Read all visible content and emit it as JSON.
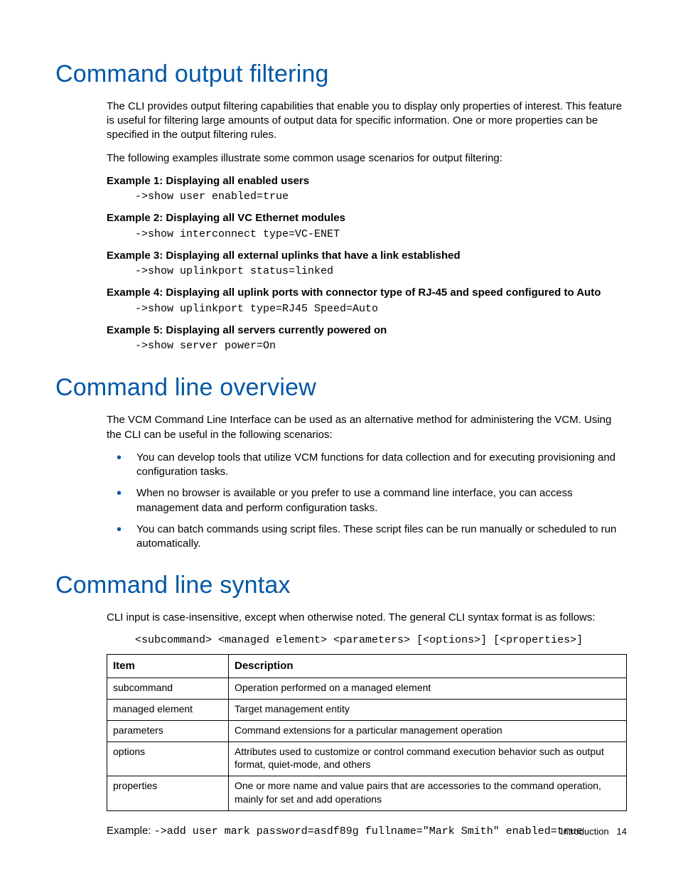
{
  "sections": {
    "filtering": {
      "heading": "Command output filtering",
      "intro_p1": "The CLI provides output filtering capabilities that enable you to display only properties of interest. This feature is useful for filtering large amounts of output data for specific information. One or more properties can be specified in the output filtering rules.",
      "intro_p2": "The following examples illustrate some common usage scenarios for output filtering:",
      "examples": [
        {
          "title": "Example 1: Displaying all enabled users",
          "code": "->show user enabled=true"
        },
        {
          "title": "Example 2: Displaying all VC Ethernet modules",
          "code": "->show interconnect type=VC-ENET"
        },
        {
          "title": "Example 3: Displaying all external uplinks that have a link established",
          "code": "->show uplinkport status=linked"
        },
        {
          "title": "Example 4: Displaying all uplink ports with connector type of RJ-45 and speed configured to Auto",
          "code": "->show uplinkport type=RJ45 Speed=Auto"
        },
        {
          "title": "Example 5: Displaying all servers currently powered on",
          "code": "->show server power=On"
        }
      ]
    },
    "overview": {
      "heading": "Command line overview",
      "intro": "The VCM Command Line Interface can be used as an alternative method for administering the VCM. Using the CLI can be useful in the following scenarios:",
      "bullets": [
        "You can develop tools that utilize VCM functions for data collection and for executing provisioning and configuration tasks.",
        "When no browser is available or you prefer to use a command line interface, you can access management data and perform configuration tasks.",
        "You can batch commands using script files. These script files can be run manually or scheduled to run automatically."
      ]
    },
    "syntax": {
      "heading": "Command line syntax",
      "intro": "CLI input is case-insensitive, except when otherwise noted. The general CLI syntax format is as follows:",
      "format": "<subcommand> <managed element> <parameters> [<options>] [<properties>]",
      "table": {
        "headers": [
          "Item",
          "Description"
        ],
        "rows": [
          [
            "subcommand",
            "Operation performed on a managed element"
          ],
          [
            "managed element",
            "Target management entity"
          ],
          [
            "parameters",
            "Command extensions for a particular management operation"
          ],
          [
            "options",
            "Attributes used to customize or control command execution behavior such as output format, quiet-mode, and others"
          ],
          [
            "properties",
            "One or more name and value pairs that are accessories to the command operation, mainly for set and add operations"
          ]
        ]
      },
      "example_label": "Example: ",
      "example_code": "->add user mark password=asdf89g fullname=\"Mark Smith\" enabled=true"
    }
  },
  "footer": {
    "section": "Introduction",
    "page": "14"
  }
}
